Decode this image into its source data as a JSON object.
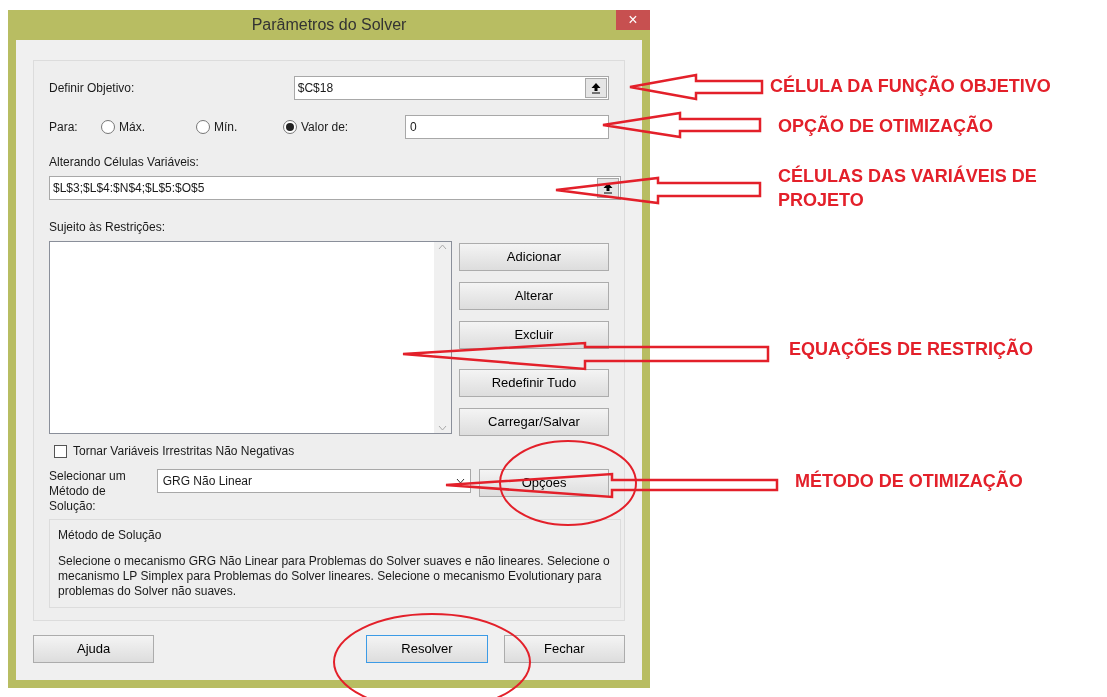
{
  "window": {
    "title": "Parâmetros do Solver",
    "close": "×"
  },
  "objective": {
    "label": "Definir Objetivo:",
    "value": "$C$18"
  },
  "to": {
    "label": "Para:",
    "options": [
      {
        "label": "Máx.",
        "selected": false
      },
      {
        "label": "Mín.",
        "selected": false
      },
      {
        "label": "Valor de:",
        "selected": true
      }
    ],
    "value": "0"
  },
  "changing": {
    "label": "Alterando Células Variáveis:",
    "value": "$L$3;$L$4:$N$4;$L$5:$O$5"
  },
  "constraints": {
    "label": "Sujeito às Restrições:",
    "buttons": [
      "Adicionar",
      "Alterar",
      "Excluir",
      "Redefinir Tudo",
      "Carregar/Salvar"
    ]
  },
  "nonnegative": {
    "label": "Tornar Variáveis Irrestritas Não Negativas",
    "checked": false
  },
  "method": {
    "label": "Selecionar um Método de Solução:",
    "value": "GRG Não Linear",
    "options_button": "Opções"
  },
  "method_info": {
    "title": "Método de Solução",
    "text": "Selecione o mecanismo GRG Não Linear para Problemas do Solver suaves e não lineares. Selecione o mecanismo LP Simplex para Problemas do Solver lineares. Selecione o mecanismo Evolutionary para problemas do Solver não suaves."
  },
  "footer": {
    "buttons": [
      {
        "label": "Ajuda",
        "focused": false
      },
      {
        "label": "Resolver",
        "focused": true
      },
      {
        "label": "Fechar",
        "focused": false
      }
    ]
  },
  "annotations": [
    {
      "kind": "arrow",
      "label": "CÉLULA DA FUNÇÃO OBJETIVO"
    },
    {
      "kind": "arrow",
      "label": "OPÇÃO DE OTIMIZAÇÃO"
    },
    {
      "kind": "arrow",
      "label": "CÉLULAS DAS VARIÁVEIS DE PROJETO"
    },
    {
      "kind": "arrow",
      "label": "EQUAÇÕES DE RESTRIÇÃO"
    },
    {
      "kind": "arrow",
      "label": "MÉTODO DE OTIMIZAÇÃO"
    }
  ]
}
